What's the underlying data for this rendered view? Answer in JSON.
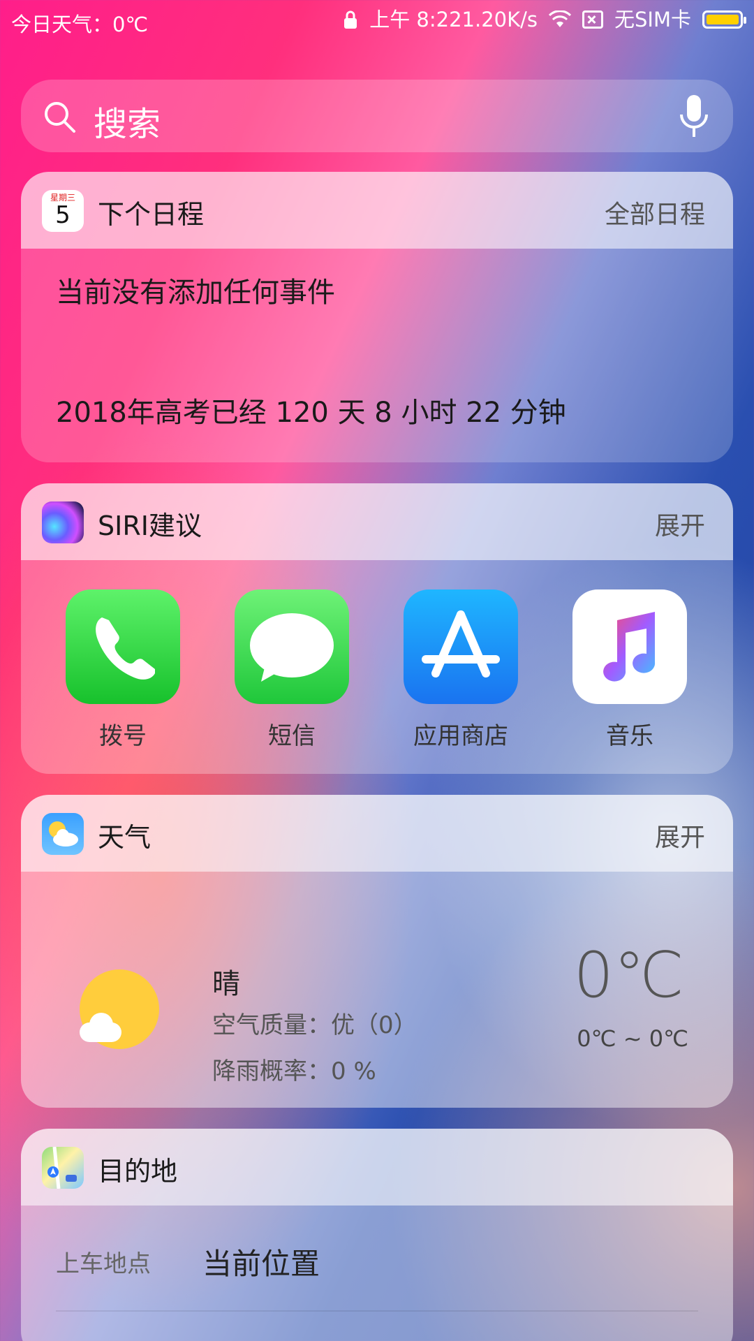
{
  "status_bar": {
    "left_text": "今日天气：0℃",
    "time": "上午 8:22",
    "speed": "1.20K/s",
    "sim": "无SIM卡"
  },
  "search": {
    "placeholder": "搜索"
  },
  "calendar_card": {
    "icon_weekday": "星期三",
    "icon_day": "5",
    "title": "下个日程",
    "action": "全部日程",
    "line1": "当前没有添加任何事件",
    "line2": "2018年高考已经 120 天 8 小时 22 分钟"
  },
  "siri_card": {
    "title": "SIRI建议",
    "action": "展开",
    "apps": [
      {
        "label": "拨号",
        "icon": "phone-icon"
      },
      {
        "label": "短信",
        "icon": "message-icon"
      },
      {
        "label": "应用商店",
        "icon": "app-store-icon"
      },
      {
        "label": "音乐",
        "icon": "music-icon"
      }
    ]
  },
  "weather_card": {
    "title": "天气",
    "action": "展开",
    "condition": "晴",
    "air_quality": "空气质量：优（0）",
    "rain": "降雨概率：0 %",
    "temperature": "0℃",
    "range": "0℃ ~ 0℃"
  },
  "maps_card": {
    "title": "目的地",
    "pickup_label": "上车地点",
    "pickup_value": "当前位置"
  },
  "colors": {
    "phone_green": "#17c12c",
    "store_blue": "#1a73f0",
    "sun_yellow": "#ffcd3c",
    "battery_yellow": "#ffd000"
  }
}
